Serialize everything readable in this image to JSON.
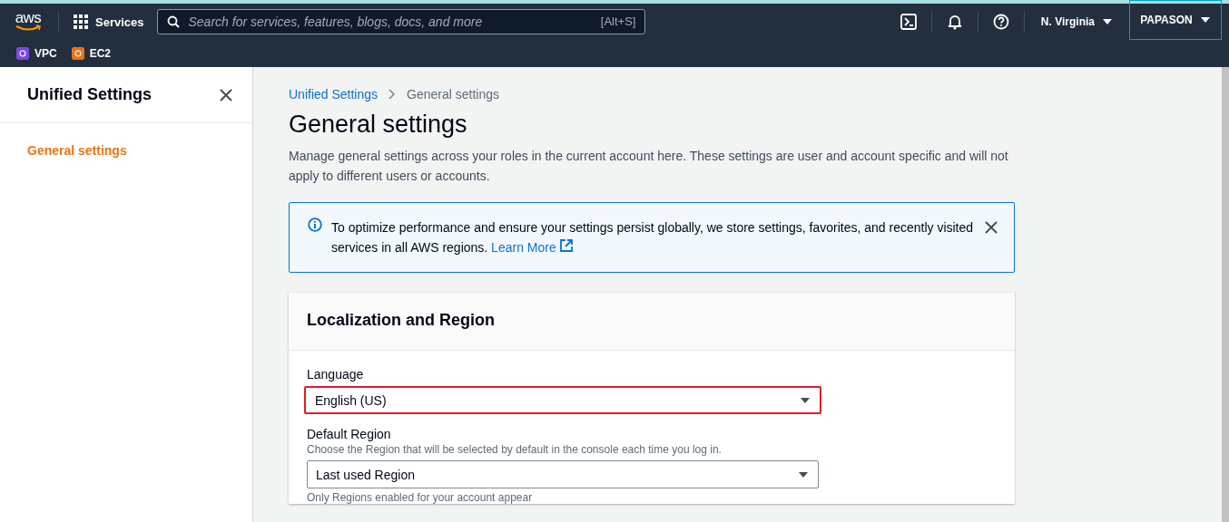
{
  "top_nav": {
    "logo": "aws",
    "services": "Services",
    "search": {
      "placeholder": "Search for services, features, blogs, docs, and more",
      "shortcut": "[Alt+S]"
    },
    "region": "N. Virginia",
    "account": "PAPASON"
  },
  "favorites": [
    {
      "label": "VPC",
      "color": "#7b48e8"
    },
    {
      "label": "EC2",
      "color": "#e8731b"
    }
  ],
  "sidebar": {
    "title": "Unified Settings",
    "items": [
      {
        "label": "General settings",
        "selected": true
      }
    ]
  },
  "breadcrumbs": [
    "Unified Settings",
    "General settings"
  ],
  "page": {
    "title": "General settings",
    "description": "Manage general settings across your roles in the current account here. These settings are user and account specific and will not apply to different users or accounts."
  },
  "alert": {
    "message": "To optimize performance and ensure your settings persist globally, we store settings, favorites, and recently visited services in all AWS regions.",
    "link": "Learn More"
  },
  "card": {
    "title": "Localization and Region",
    "fields": [
      {
        "label": "Language",
        "value": "English (US)",
        "highlighted": true
      },
      {
        "label": "Default Region",
        "hint": "Choose the Region that will be selected by default in the console each time you log in.",
        "value": "Last used Region",
        "highlighted": false,
        "note": "Only Regions enabled for your account appear"
      }
    ]
  }
}
